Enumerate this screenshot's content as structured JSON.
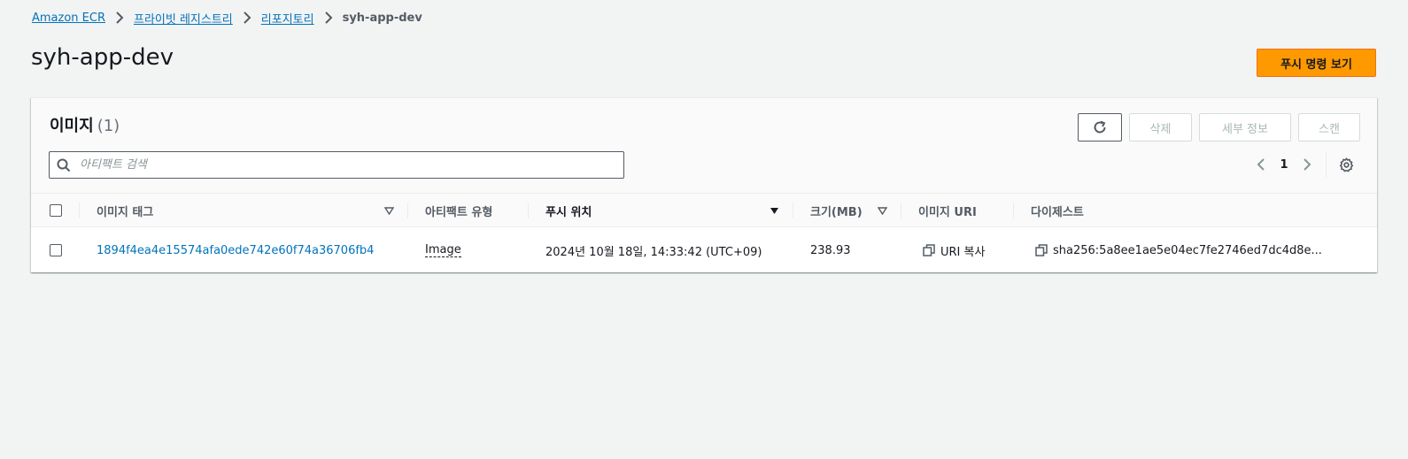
{
  "breadcrumb": {
    "items": [
      "Amazon ECR",
      "프라이빗 레지스트리",
      "리포지토리"
    ],
    "current": "syh-app-dev"
  },
  "page": {
    "title": "syh-app-dev",
    "push_button": "푸시 명령 보기"
  },
  "panel": {
    "title": "이미지",
    "count": "(1)",
    "buttons": {
      "delete": "삭제",
      "details": "세부 정보",
      "scan": "스캔"
    },
    "search_placeholder": "아티팩트 검색",
    "pagination": {
      "current_page": "1"
    }
  },
  "table": {
    "columns": [
      "이미지 태그",
      "아티팩트 유형",
      "푸시 위치",
      "크기(MB)",
      "이미지 URI",
      "다이제스트"
    ],
    "rows": [
      {
        "tag": "1894f4ea4e15574afa0ede742e60f74a36706fb4",
        "artifact_type": "Image",
        "pushed_at": "2024년 10월 18일, 14:33:42 (UTC+09)",
        "size": "238.93",
        "uri_label": "URI 복사",
        "digest": "sha256:5a8ee1ae5e04ec7fe2746ed7dc4d8e..."
      }
    ]
  },
  "colors": {
    "link": "#0073bb",
    "primary_button": "#ff9900",
    "background": "#f2f3f3"
  }
}
